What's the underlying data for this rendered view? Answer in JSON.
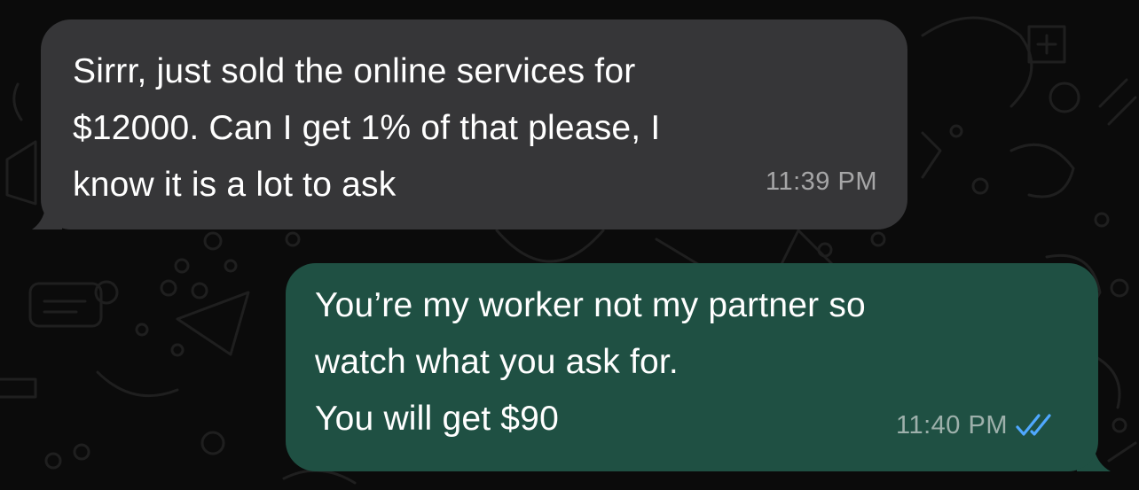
{
  "conversation": {
    "messages": [
      {
        "direction": "incoming",
        "text": "Sirrr, just sold the online services for\n$12000. Can I get 1% of that please, I\nknow it is a lot to ask",
        "time": "11:39 PM"
      },
      {
        "direction": "outgoing",
        "text": "You’re my worker not my partner so\nwatch what you ask for.\nYou will get $90",
        "time": "11:40 PM",
        "status_icon": "double-check-read-icon"
      }
    ]
  },
  "colors": {
    "background": "#0b0b0b",
    "incoming_bubble": "#363638",
    "outgoing_bubble": "#1f5043",
    "read_ticks": "#4fa8ff"
  }
}
